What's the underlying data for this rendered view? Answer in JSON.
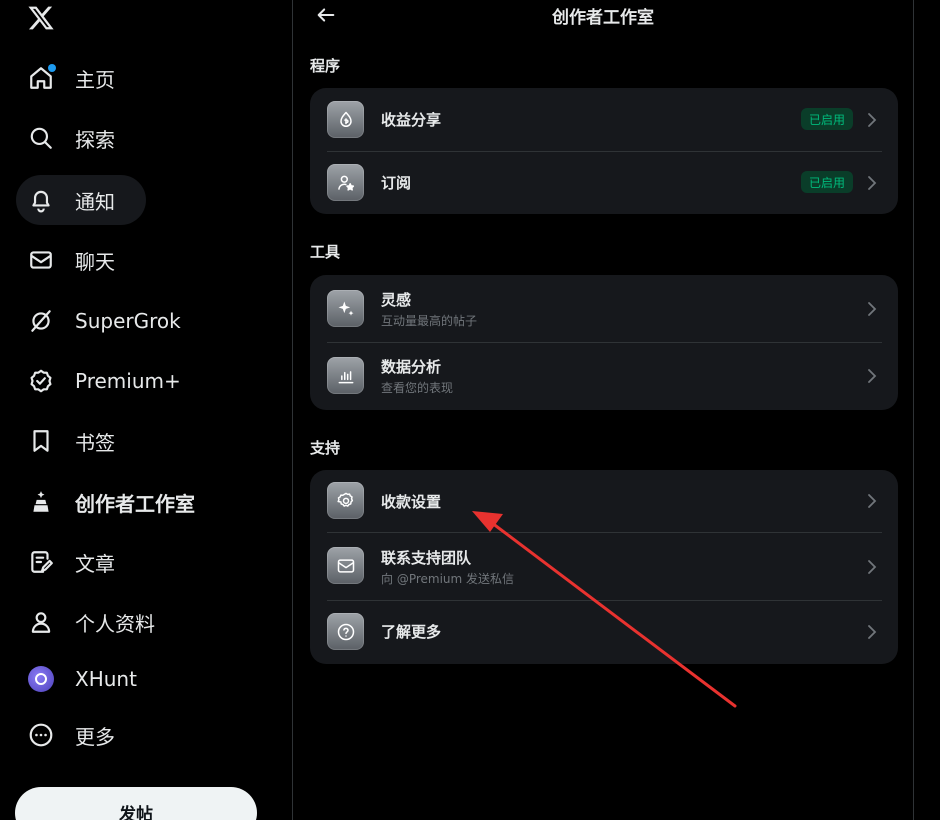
{
  "sidebar": {
    "logo": "x-logo-icon",
    "items": [
      {
        "label": "主页",
        "icon": "home-icon",
        "notification": true
      },
      {
        "label": "探索",
        "icon": "search-icon"
      },
      {
        "label": "通知",
        "icon": "bell-icon"
      },
      {
        "label": "聊天",
        "icon": "mail-icon"
      },
      {
        "label": "SuperGrok",
        "icon": "grok-icon"
      },
      {
        "label": "Premium+",
        "icon": "verified-icon"
      },
      {
        "label": "书签",
        "icon": "bookmark-icon"
      },
      {
        "label": "创作者工作室",
        "icon": "creator-studio-icon",
        "active": true
      },
      {
        "label": "文章",
        "icon": "article-icon"
      },
      {
        "label": "个人资料",
        "icon": "person-icon"
      },
      {
        "label": "XHunt",
        "icon": "xhunt-avatar-icon"
      },
      {
        "label": "更多",
        "icon": "more-icon"
      }
    ],
    "post_button": "发帖"
  },
  "header": {
    "title": "创作者工作室",
    "back_icon": "back-arrow-icon"
  },
  "sections": [
    {
      "title": "程序",
      "rows": [
        {
          "title": "收益分享",
          "icon": "monetization-icon",
          "status": "已启用"
        },
        {
          "title": "订阅",
          "icon": "subscription-icon",
          "status": "已启用"
        }
      ]
    },
    {
      "title": "工具",
      "rows": [
        {
          "title": "灵感",
          "subtitle": "互动量最高的帖子",
          "icon": "sparkle-icon"
        },
        {
          "title": "数据分析",
          "subtitle": "查看您的表现",
          "icon": "analytics-icon"
        }
      ]
    },
    {
      "title": "支持",
      "rows": [
        {
          "title": "收款设置",
          "icon": "settings-gear-icon"
        },
        {
          "title": "联系支持团队",
          "subtitle": "向 @Premium 发送私信",
          "icon": "mail-icon"
        },
        {
          "title": "了解更多",
          "icon": "help-icon"
        }
      ]
    }
  ],
  "colors": {
    "accent": "#1d9bf0",
    "status_green": "#00ba7c",
    "annotation_arrow": "#e8322f"
  }
}
